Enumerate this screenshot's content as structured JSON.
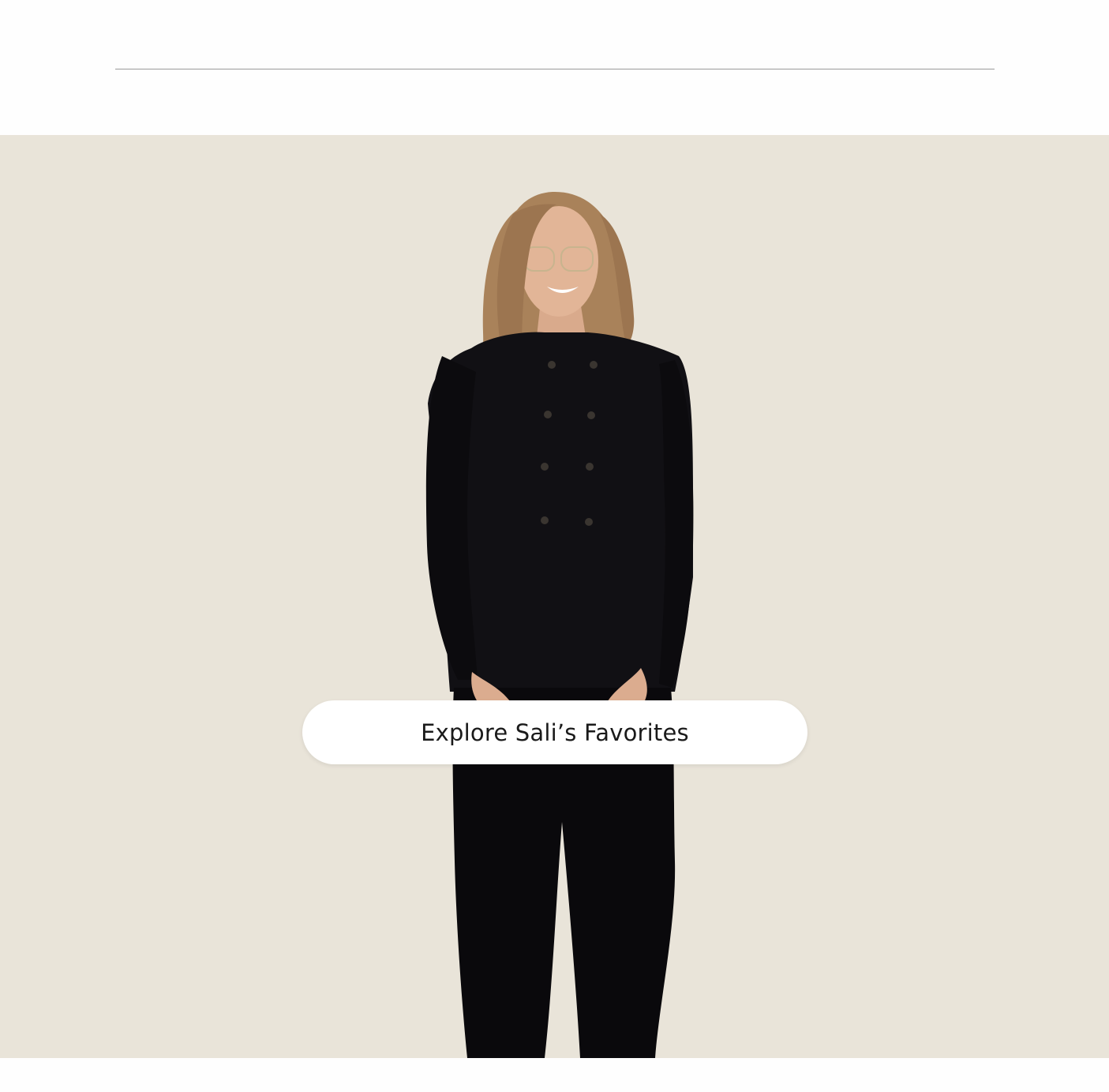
{
  "cta": {
    "label": "Explore Sali’s Favorites"
  },
  "hero": {
    "image": "woman-in-black-double-breasted-suit-photo",
    "background_color": "#e9e4d9"
  },
  "colors": {
    "divider": "#9a9a9a",
    "cta_background": "#ffffff",
    "cta_text": "#1a1a1a"
  }
}
